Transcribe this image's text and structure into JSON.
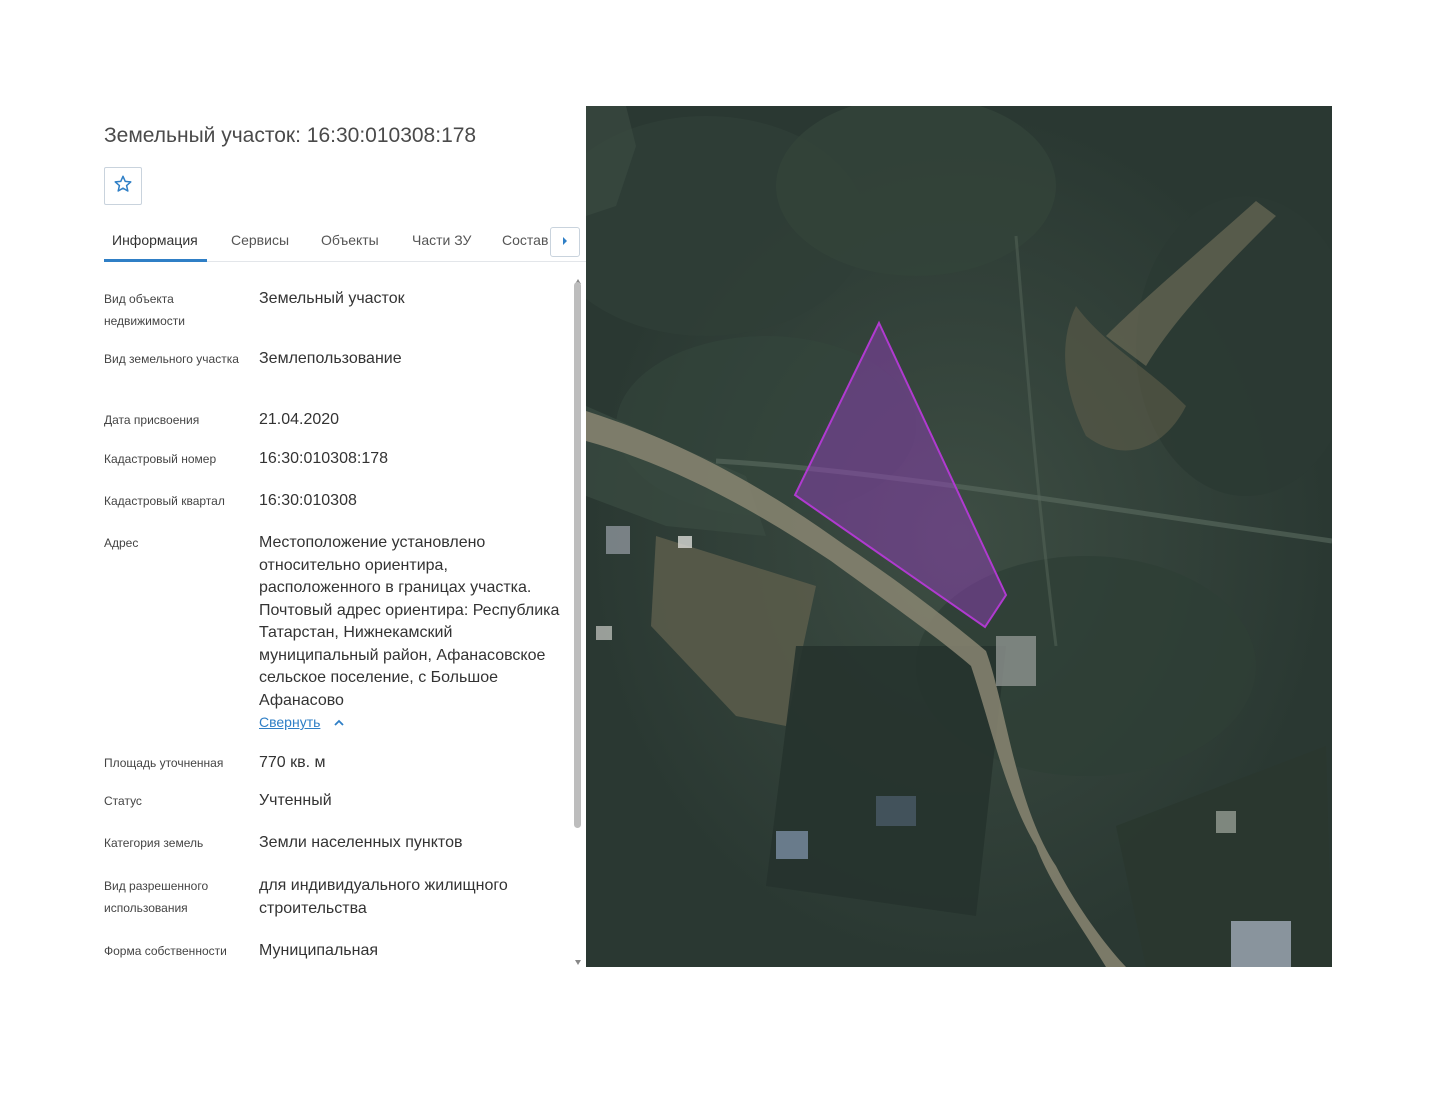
{
  "header": {
    "title": "Земельный участок: 16:30:010308:178",
    "favorite_icon": "star-icon"
  },
  "tabs": [
    {
      "label": "Информация",
      "active": true
    },
    {
      "label": "Сервисы"
    },
    {
      "label": "Объекты"
    },
    {
      "label": "Части ЗУ"
    },
    {
      "label": "Состав"
    }
  ],
  "tabs_next_icon": "chevron-right-icon",
  "details": [
    {
      "label": "Вид объекта недвижимости",
      "value": "Земельный участок"
    },
    {
      "label": "Вид земельного участка",
      "value": "Землепользование"
    },
    {
      "label": "Дата присвоения",
      "value": "21.04.2020"
    },
    {
      "label": "Кадастровый номер",
      "value": "16:30:010308:178"
    },
    {
      "label": "Кадастровый квартал",
      "value": "16:30:010308"
    },
    {
      "label": "Адрес",
      "value": "Местоположение установлено относительно ориентира, расположенного в границах участка. Почтовый адрес ориентира: Республика Татарстан, Нижнекамский муниципальный район, Афанасовское сельское поселение, с Большое Афанасово"
    },
    {
      "label": "Площадь уточненная",
      "value": "770 кв. м"
    },
    {
      "label": "Статус",
      "value": "Учтенный"
    },
    {
      "label": "Категория земель",
      "value": "Земли населенных пунктов"
    },
    {
      "label": "Вид разрешенного использования",
      "value": "для индивидуального жилищного строительства"
    },
    {
      "label": "Форма собственности",
      "value": "Муниципальная"
    }
  ],
  "address_collapse": {
    "label": "Свернуть",
    "icon": "chevron-up-icon"
  },
  "map": {
    "type": "satellite",
    "parcel_outline_color": "#b03ad0",
    "parcel_fill_color": "#9a3fc4"
  }
}
